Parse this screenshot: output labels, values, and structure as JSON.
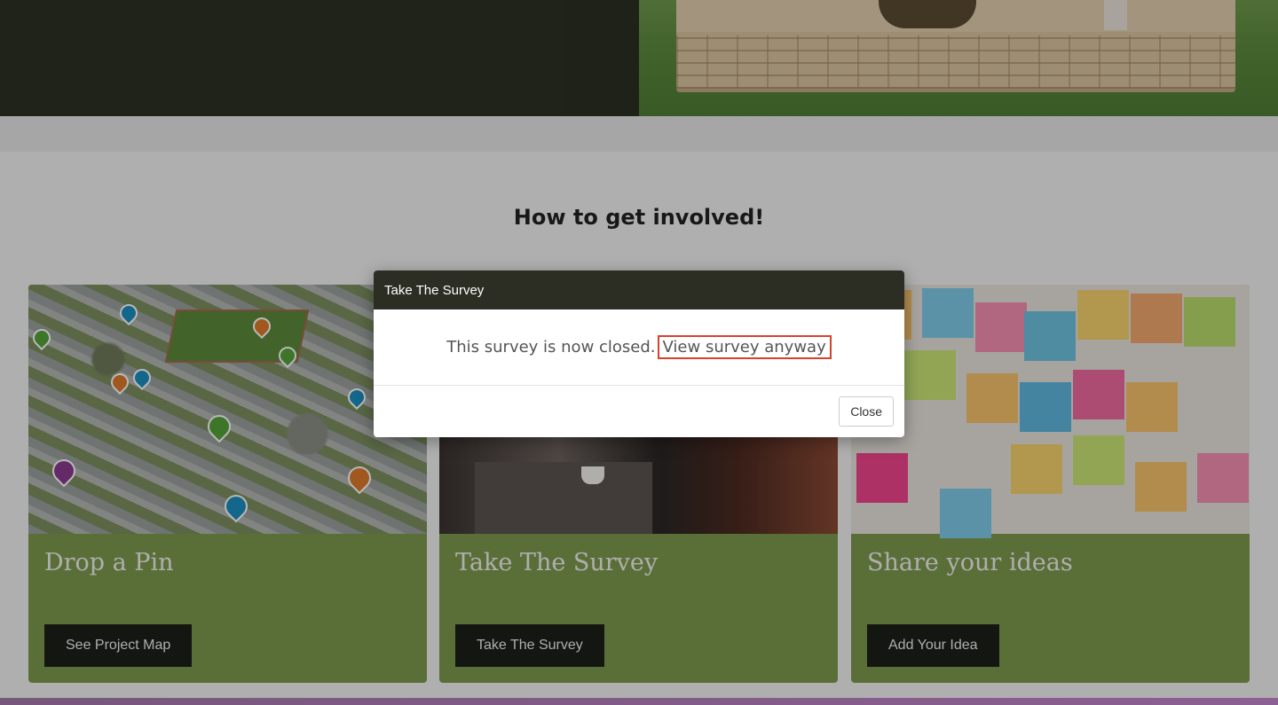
{
  "section": {
    "title": "How to get involved!"
  },
  "cards": [
    {
      "title": "Drop a Pin",
      "button": "See Project Map"
    },
    {
      "title": "Take The Survey",
      "button": "Take The Survey"
    },
    {
      "title": "Share your ideas",
      "button": "Add Your Idea"
    }
  ],
  "modal": {
    "title": "Take The Survey",
    "message": "This survey is now closed.",
    "link": "View survey anyway",
    "close": "Close"
  },
  "colors": {
    "card_green": "#7d9a4d",
    "button_dark": "#1d1f1a",
    "modal_header": "#2c2e24",
    "highlight_border": "#d8412e"
  },
  "icons": [
    "map-pin-icon",
    "speech-bubble-icon"
  ]
}
